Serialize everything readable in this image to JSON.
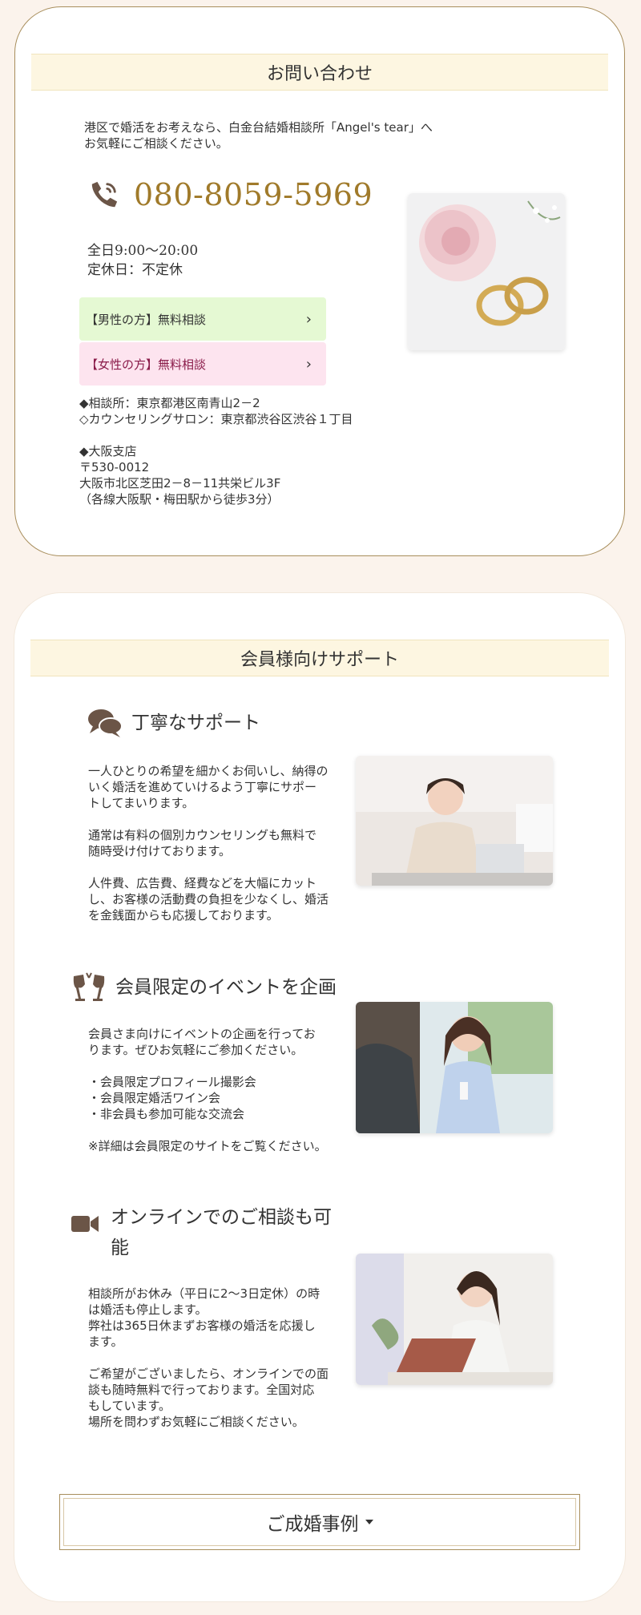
{
  "contact": {
    "title": "お問い合わせ",
    "intro_line1": "港区で婚活をお考えなら、白金台結婚相談所「Angel's tear」へ",
    "intro_line2": "お気軽にご相談ください。",
    "phone": "080-8059-5969",
    "hours_line1": "全日9:00～20:00",
    "hours_line2": "定休日：不定休",
    "men_button": "【男性の方】無料相談",
    "women_button": "【女性の方】無料相談",
    "chevron": "›",
    "address_lines": [
      "◆相談所：東京都港区南青山2－2",
      "◇カウンセリングサロン：東京都渋谷区渋谷１丁目",
      "",
      "◆大阪支店",
      "〒530-0012",
      "大阪市北区芝田2－8－11共栄ビル3F",
      "（各線大阪駅・梅田駅から徒歩3分）"
    ]
  },
  "support": {
    "title": "会員様向けサポート",
    "sections": [
      {
        "heading": "丁寧なサポート",
        "icon": "chat-bubbles-icon",
        "paragraphs": [
          "一人ひとりの希望を細かくお伺いし、納得の\nいく婚活を進めていけるよう丁寧にサポー\nトしてまいります。",
          "通常は有料の個別カウンセリングも無料で\n随時受け付けております。",
          "人件費、広告費、経費などを大幅にカット\nし、お客様の活動費の負担を少なくし、婚活\nを金銭面からも応援しております。"
        ]
      },
      {
        "heading": "会員限定のイベントを企画",
        "icon": "wine-glasses-icon",
        "paragraphs": [
          "会員さま向けにイベントの企画を行ってお\nります。ぜひお気軽にご参加ください。",
          "・会員限定プロフィール撮影会\n・会員限定婚活ワイン会\n・非会員も参加可能な交流会",
          "※詳細は会員限定のサイトをご覧ください。"
        ]
      },
      {
        "heading_line1": "オンラインでのご相談も可",
        "heading_line2": "能",
        "icon": "video-camera-icon",
        "paragraphs": [
          "相談所がお休み（平日に2～3日定休）の時\nは婚活も停止します。\n弊社は365日休まずお客様の婚活を応援し\nます。",
          "ご希望がございましたら、オンラインでの面\n談も随時無料で行っております。全国対応\nもしています。\n場所を問わずお気軽にご相談ください。"
        ]
      }
    ],
    "cases_button": "ご成婚事例"
  },
  "colors": {
    "page_bg": "#fbf3ec",
    "gold": "#a07a2a",
    "title_band": "#fdf6e1",
    "men_button_bg": "#e5f9d3",
    "women_button_bg": "#fde4ef",
    "women_button_text": "#8a1c4a",
    "icon_brown": "#6b5547"
  }
}
